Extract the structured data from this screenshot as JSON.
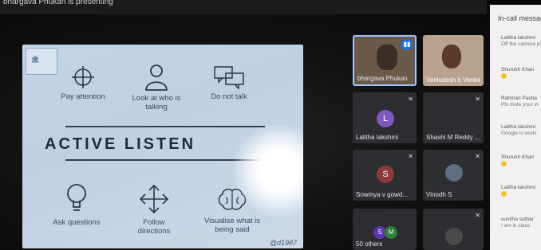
{
  "header": {
    "presenting_text": "bhargava Phukan is presenting"
  },
  "slide": {
    "logo_text": "🏛",
    "title": "ACTIVE LISTEN",
    "top_items": [
      "Pay attention",
      "Look at who is talking",
      "Do not talk"
    ],
    "bottom_items": [
      "Ask questions",
      "Follow directions",
      "Visualise what is being said"
    ],
    "watermark": "@d1987"
  },
  "participants": [
    {
      "name": "bhargava Phukan",
      "speaking": true
    },
    {
      "name": "Venkatesh b Venke..."
    },
    {
      "name": "Lalitha lakshmi",
      "initial": "L",
      "color": "#7e57c2"
    },
    {
      "name": "Shashi M Reddy ..."
    },
    {
      "name": "Sowmya v gowd...",
      "initial": "S",
      "color": "#8d3a3a"
    },
    {
      "name": "Vinodh S"
    },
    {
      "name": "50 others",
      "initials": [
        "S",
        "M"
      ]
    },
    {
      "name": ""
    }
  ],
  "chat": {
    "title": "In-call messages",
    "messages": [
      {
        "sender": "Lalitha lakshmi",
        "text": "Off the camera pl"
      },
      {
        "sender": "Shurukh Khan",
        "text": "emoji"
      },
      {
        "sender": "Rahman Pasha",
        "text": "Pls mute your vi"
      },
      {
        "sender": "Lalitha lakshmi",
        "text": "Google is worki"
      },
      {
        "sender": "Shurukh Khan",
        "text": "emoji"
      },
      {
        "sender": "Lalitha lakshmi",
        "text": "emoji"
      },
      {
        "sender": "sunitha suthar",
        "text": "I am in class"
      }
    ]
  }
}
